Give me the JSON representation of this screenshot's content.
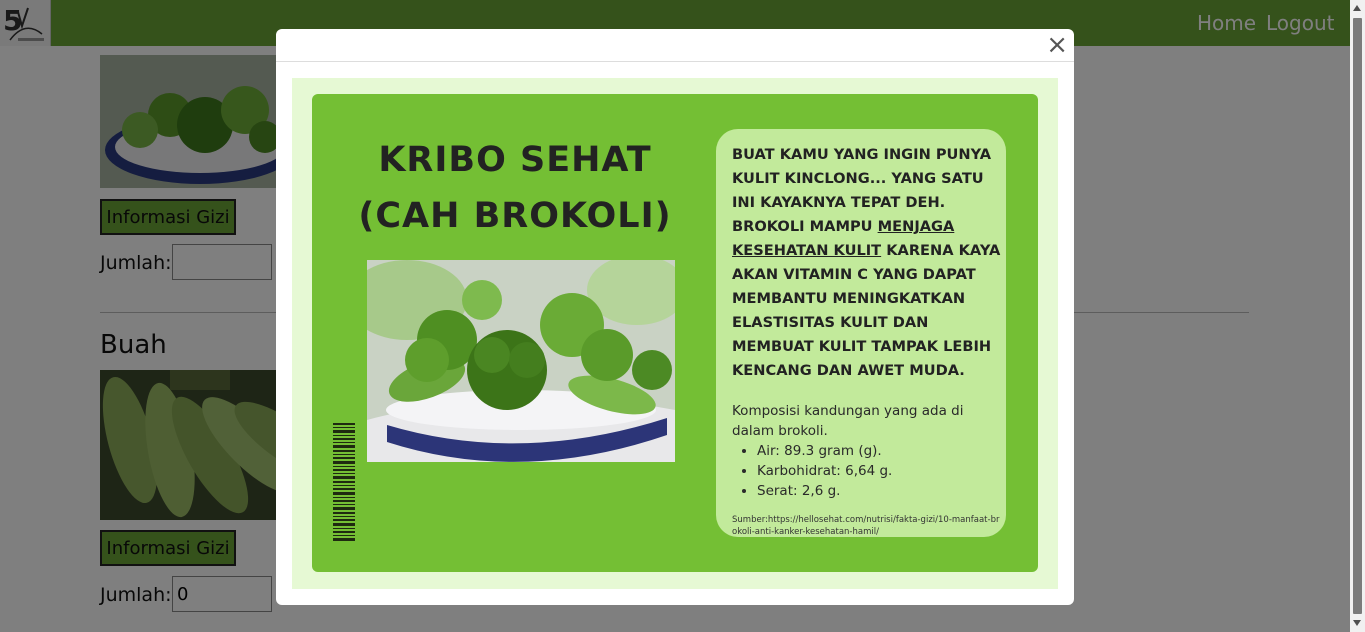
{
  "nav": {
    "home_label": "Home",
    "logout_label": "Logout"
  },
  "sections": [
    {
      "title": "",
      "button_label": "Informasi Gizi",
      "jumlah_label": "Jumlah:",
      "jumlah_value": ""
    },
    {
      "title": "Buah",
      "button_label": "Informasi Gizi",
      "jumlah_label": "Jumlah:",
      "jumlah_value": "0"
    }
  ],
  "modal": {
    "close_label": "×",
    "poster": {
      "title": "KRIBO SEHAT\n(CAH BROKOLI)",
      "bold_text_before": "BUAT KAMU YANG INGIN PUNYA KULIT KINCLONG... YANG SATU INI KAYAKNYA TEPAT DEH. BROKOLI MAMPU ",
      "bold_text_underlined": "MENJAGA KESEHATAN KULIT",
      "bold_text_after": " KARENA KAYA AKAN VITAMIN C YANG DAPAT MEMBANTU MENINGKATKAN ELASTISITAS KULIT DAN MEMBUAT KULIT TAMPAK LEBIH KENCANG DAN AWET MUDA.",
      "composition_intro": "Komposisi kandungan yang ada di dalam brokoli.",
      "composition_items": [
        "Air: 89.3 gram (g).",
        "Karbohidrat: 6,64 g.",
        "Serat: 2,6 g."
      ],
      "source": "Sumber:https://hellosehat.com/nutrisi/fakta-gizi/10-manfaat-brokoli-anti-kanker-kesehatan-hamil/"
    }
  },
  "colors": {
    "navbar": "#6aa536",
    "poster_green": "#74bf34",
    "card_green": "#c2ea9b",
    "poster_bg": "#e6f9d4"
  }
}
